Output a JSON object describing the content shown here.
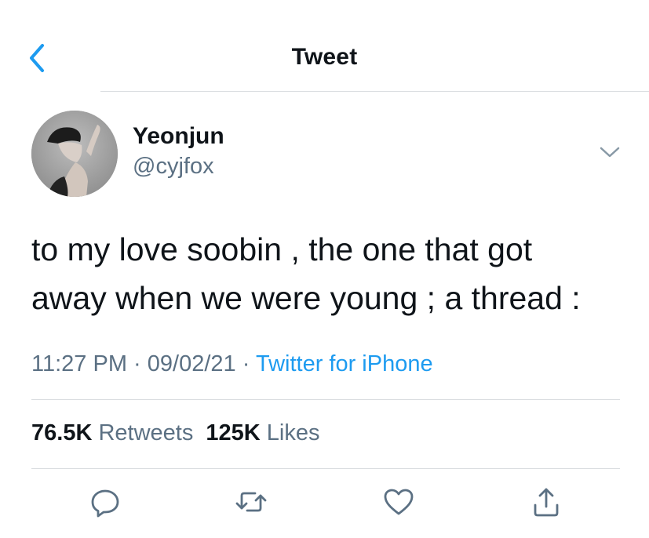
{
  "header": {
    "title": "Tweet",
    "back_icon": "chevron-left-icon",
    "accent_color": "#1d9bf0"
  },
  "author": {
    "display_name": "Yeonjun",
    "handle": "@cyjfox",
    "more_icon": "chevron-down-icon"
  },
  "tweet": {
    "text": "to my love soobin , the one that got\naway when we were young ; a thread :"
  },
  "meta": {
    "time": "11:27 PM",
    "separator": "·",
    "date": "09/02/21",
    "source": "Twitter for iPhone"
  },
  "stats": {
    "retweets_count": "76.5K",
    "retweets_label": "Retweets",
    "likes_count": "125K",
    "likes_label": "Likes"
  },
  "actions": {
    "reply_icon": "reply-icon",
    "retweet_icon": "retweet-icon",
    "like_icon": "heart-icon",
    "share_icon": "share-icon"
  }
}
